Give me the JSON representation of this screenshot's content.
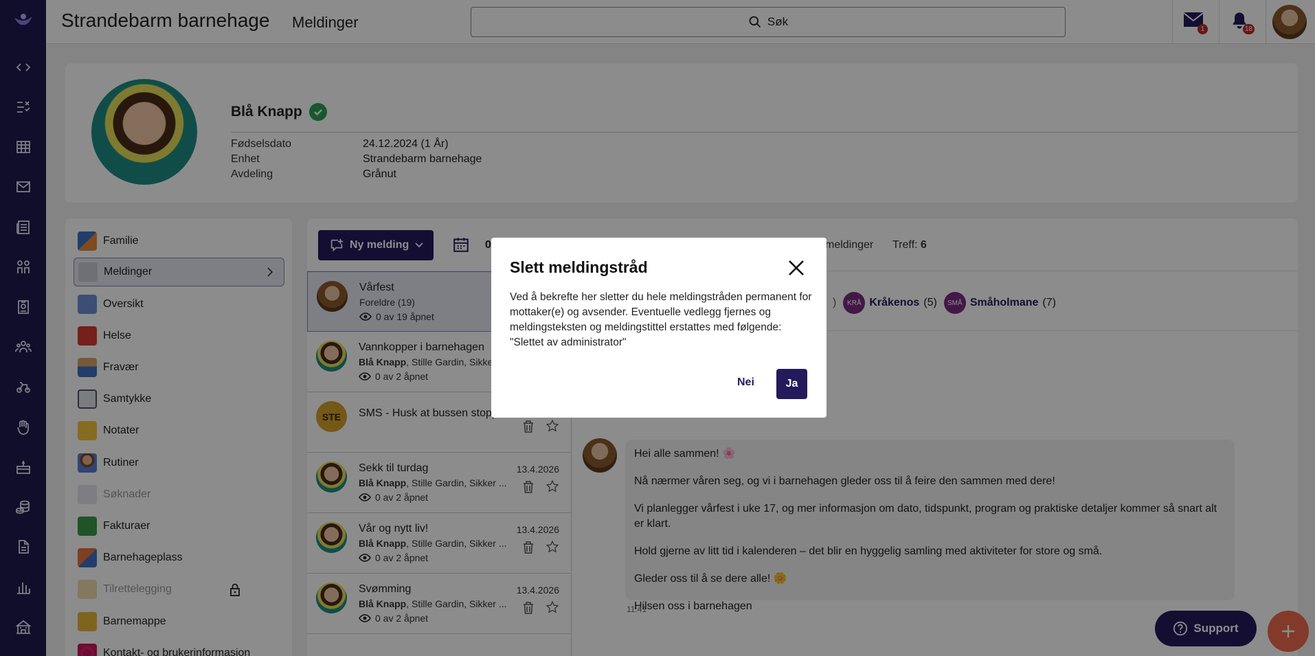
{
  "topbar": {
    "school_name": "Strandebarm barnehage",
    "section_title": "Meldinger",
    "search_label": "Søk",
    "mail_badge": "1",
    "notif_badge": "18"
  },
  "profile": {
    "name": "Blå Knapp",
    "fields": [
      {
        "label": "Fødselsdato",
        "value": "24.12.2024 (1 År)"
      },
      {
        "label": "Enhet",
        "value": "Strandebarm barnehage"
      },
      {
        "label": "Avdeling",
        "value": "Grånut"
      }
    ]
  },
  "sidemenu": {
    "items": [
      {
        "label": "Familie"
      },
      {
        "label": "Meldinger"
      },
      {
        "label": "Oversikt"
      },
      {
        "label": "Helse"
      },
      {
        "label": "Fravær"
      },
      {
        "label": "Samtykke"
      },
      {
        "label": "Notater"
      },
      {
        "label": "Rutiner"
      },
      {
        "label": "Søknader"
      },
      {
        "label": "Fakturaer"
      },
      {
        "label": "Barnehageplass"
      },
      {
        "label": "Tilrettelegging"
      },
      {
        "label": "Barnemappe"
      },
      {
        "label": "Kontakt- og brukerinformasjon"
      }
    ]
  },
  "toolbar": {
    "new_message": "Ny melding",
    "date_partial": "0",
    "filter_partial": "meldinger",
    "treff_label": "Treff:",
    "treff_count": "6"
  },
  "messages": [
    {
      "title": "Vårfest",
      "sub_bold": "",
      "sub": "Foreldre (19)",
      "opened": "0 av 19 åpnet",
      "date": ""
    },
    {
      "title": "Vannkopper i barnehagen",
      "sub_bold": "Blå Knapp",
      "sub": ", Stille Gardin, Sikker",
      "opened": "0 av 2 åpnet",
      "date": ""
    },
    {
      "title": "SMS - Husk at bussen stopp",
      "initials": "STE",
      "opened": "",
      "date": ""
    },
    {
      "title": "Sekk til turdag",
      "sub_bold": "Blå Knapp",
      "sub": ", Stille Gardin, Sikker ...",
      "opened": "0 av 2 åpnet",
      "date": "13.4.2026"
    },
    {
      "title": "Vår og nytt liv!",
      "sub_bold": "Blå Knapp",
      "sub": ", Stille Gardin, Sikker ...",
      "opened": "0 av 2 åpnet",
      "date": "13.4.2026"
    },
    {
      "title": "Svømming",
      "sub_bold": "Blå Knapp",
      "sub": ", Stille Gardin, Sikker ...",
      "opened": "0 av 2 åpnet",
      "date": "13.4.2026"
    }
  ],
  "recipients": [
    {
      "badge": "KRÅ",
      "name": "Kråkenos",
      "count": "(5)"
    },
    {
      "badge": "SMÅ",
      "name": "Småholmane",
      "count": "(7)"
    }
  ],
  "recipients_partial": ")",
  "message_body": {
    "lines": [
      "Hei alle sammen! 🌸",
      "Nå nærmer våren seg, og vi i barnehagen gleder oss til å feire den sammen med dere!",
      "Vi planlegger vårfest i uke 17, og mer informasjon om dato, tidspunkt, program og praktiske detaljer kommer så snart alt er klart.",
      "Hold gjerne av litt tid i kalenderen – det blir en hyggelig samling med aktiviteter for store og små.",
      "Gleder oss til å se dere alle! 🌼",
      "Hilsen oss i barnehagen"
    ],
    "time": "11:41"
  },
  "modal": {
    "title": "Slett meldingstråd",
    "body": "Ved å bekrefte her sletter du hele meldingstråden permanent for mottaker(e) og avsender. Eventuelle vedlegg fjernes og meldingsteksten og meldingstittel erstattes med følgende: \"Slettet av administrator\"",
    "no": "Nei",
    "yes": "Ja"
  },
  "support_label": "Support",
  "colors": {
    "primary": "#231b5c",
    "rail": "#1f1a4f",
    "fab": "#ef6a4d"
  }
}
